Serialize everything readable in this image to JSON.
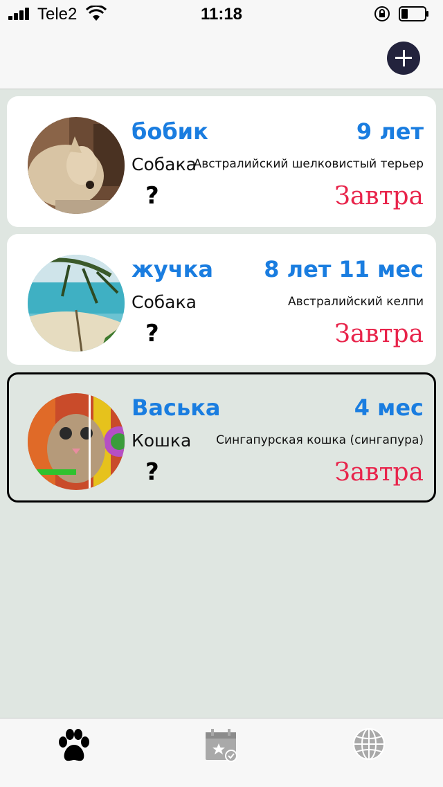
{
  "status_bar": {
    "carrier": "Tele2",
    "time": "11:18"
  },
  "pets": [
    {
      "name": "бобик",
      "age": "9 лет",
      "type": "Собака",
      "breed": "Австралийский шелковистый терьер",
      "question": "?",
      "next_event": "Завтра",
      "photo": "dog-photo"
    },
    {
      "name": "жучка",
      "age": "8 лет 11 мес",
      "type": "Собака",
      "breed": "Австралийский келпи",
      "question": "?",
      "next_event": "Завтра",
      "photo": "beach-photo"
    },
    {
      "name": "Васька",
      "age": "4 мес",
      "type": "Кошка",
      "breed": "Сингапурская кошка (сингапура)",
      "question": "?",
      "next_event": "Завтра",
      "photo": "cat-photo"
    }
  ],
  "colors": {
    "accent_blue": "#1a7de0",
    "accent_red": "#e8234a",
    "add_button": "#23233d",
    "background": "#dfe6e1"
  },
  "tabs": [
    {
      "icon": "paw-icon",
      "active": true
    },
    {
      "icon": "calendar-star-icon",
      "active": false
    },
    {
      "icon": "globe-icon",
      "active": false
    }
  ]
}
